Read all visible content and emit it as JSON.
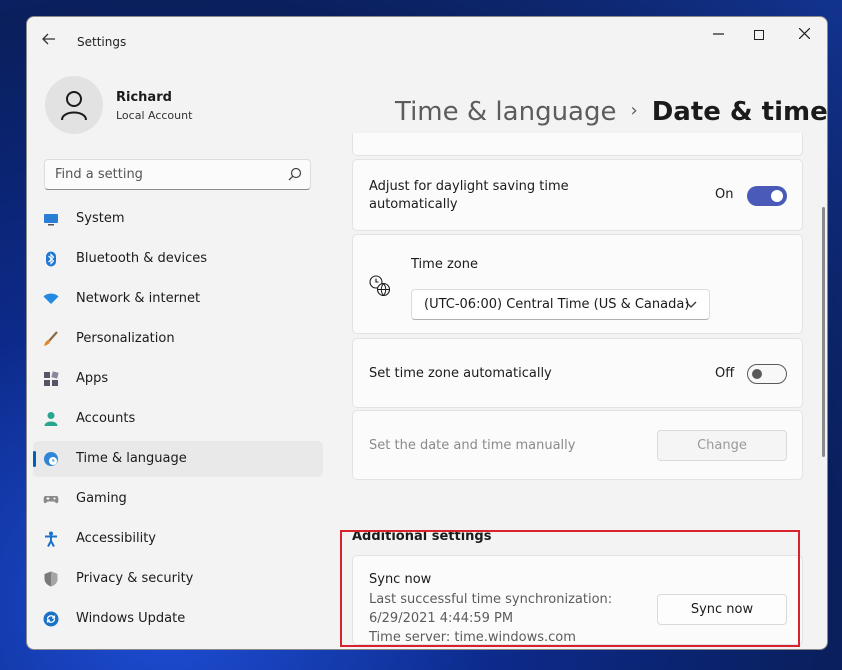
{
  "window": {
    "title": "Settings"
  },
  "profile": {
    "name": "Richard",
    "account_type": "Local Account"
  },
  "search": {
    "placeholder": "Find a setting"
  },
  "nav": {
    "items": [
      {
        "label": "System",
        "icon": "monitor-icon"
      },
      {
        "label": "Bluetooth & devices",
        "icon": "bluetooth-icon"
      },
      {
        "label": "Network & internet",
        "icon": "wifi-icon"
      },
      {
        "label": "Personalization",
        "icon": "brush-icon"
      },
      {
        "label": "Apps",
        "icon": "apps-icon"
      },
      {
        "label": "Accounts",
        "icon": "person-icon"
      },
      {
        "label": "Time & language",
        "icon": "globe-clock-icon",
        "active": true
      },
      {
        "label": "Gaming",
        "icon": "gamepad-icon"
      },
      {
        "label": "Accessibility",
        "icon": "accessibility-icon"
      },
      {
        "label": "Privacy & security",
        "icon": "shield-icon"
      },
      {
        "label": "Windows Update",
        "icon": "refresh-icon"
      }
    ]
  },
  "header": {
    "parent": "Time & language",
    "current": "Date & time",
    "separator": "›"
  },
  "settings": {
    "dst": {
      "label": "Adjust for daylight saving time automatically",
      "state": "On",
      "enabled": true
    },
    "timezone": {
      "label": "Time zone",
      "value": "(UTC-06:00) Central Time (US & Canada)"
    },
    "auto_tz": {
      "label": "Set time zone automatically",
      "state": "Off",
      "enabled": false
    },
    "manual": {
      "label": "Set the date and time manually",
      "button": "Change"
    }
  },
  "additional": {
    "title": "Additional settings",
    "sync": {
      "title": "Sync now",
      "last_sync_label": "Last successful time synchronization:",
      "last_sync_value": "6/29/2021 4:44:59 PM",
      "server": "Time server: time.windows.com",
      "button": "Sync now"
    }
  },
  "colors": {
    "accent": "#4a5ab8",
    "highlight": "#d8232e",
    "active_indicator": "#005fb8"
  }
}
